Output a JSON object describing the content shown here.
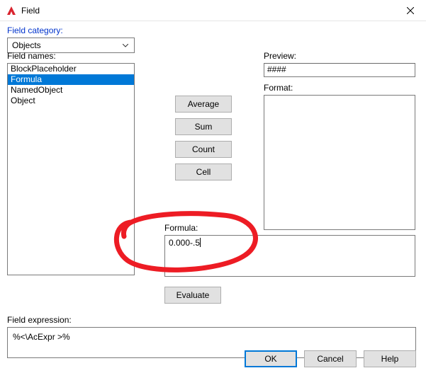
{
  "window": {
    "title": "Field"
  },
  "category": {
    "label": "Field category:",
    "selected": "Objects"
  },
  "names": {
    "label": "Field names:",
    "items": [
      "BlockPlaceholder",
      "Formula",
      "NamedObject",
      "Object"
    ],
    "selected_index": 1
  },
  "mid_buttons": {
    "average": "Average",
    "sum": "Sum",
    "count": "Count",
    "cell": "Cell"
  },
  "preview": {
    "label": "Preview:",
    "value": "####"
  },
  "format": {
    "label": "Format:"
  },
  "formula": {
    "label": "Formula:",
    "value": "0.000-.5"
  },
  "evaluate": {
    "label": "Evaluate"
  },
  "expression": {
    "label": "Field expression:",
    "value": "%<\\AcExpr >%"
  },
  "footer": {
    "ok": "OK",
    "cancel": "Cancel",
    "help": "Help"
  }
}
